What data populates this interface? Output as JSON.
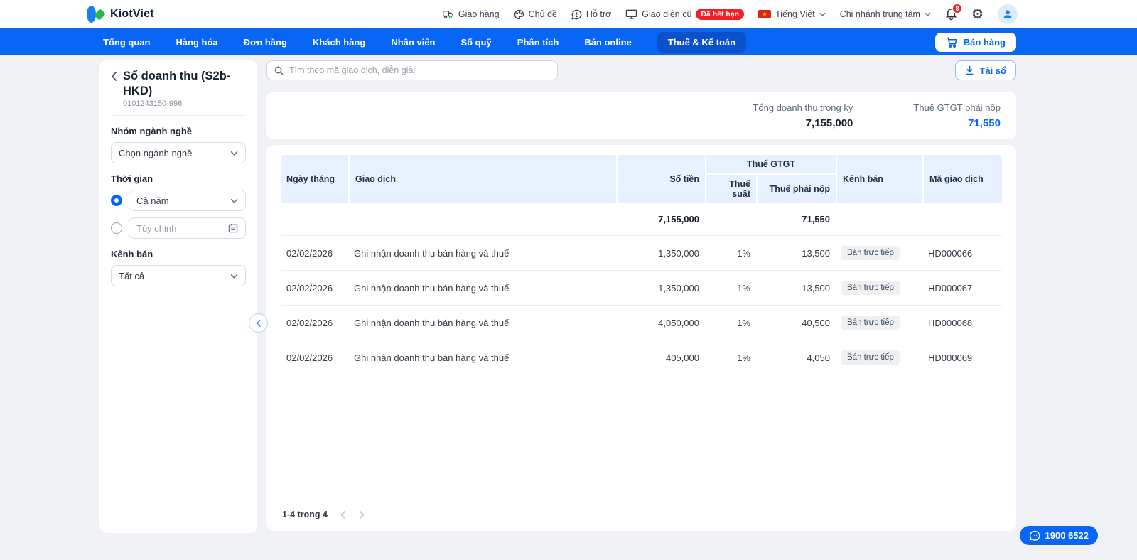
{
  "header": {
    "logo_text": "KiotViet",
    "delivery_label": "Giao hàng",
    "theme_label": "Chủ đề",
    "support_label": "Hỗ trợ",
    "old_ui_label": "Giao diện cũ",
    "expired_badge": "Đã hết hạn",
    "language_label": "Tiếng Việt",
    "branch_label": "Chi nhánh trung tâm",
    "notification_count": "8"
  },
  "nav": {
    "tabs": [
      "Tổng quan",
      "Hàng hóa",
      "Đơn hàng",
      "Khách hàng",
      "Nhân viên",
      "Sổ quỹ",
      "Phân tích",
      "Bán online",
      "Thuế & Kế toán"
    ],
    "active_tab": "Thuế & Kế toán",
    "sell_button": "Bán hàng"
  },
  "page": {
    "title": "Sổ doanh thu (S2b-HKD)",
    "subtitle": "0101243150-996",
    "search_placeholder": "Tìm theo mã giao dịch, diễn giải",
    "download_button": "Tải sổ"
  },
  "filters": {
    "industry_label": "Nhóm ngành nghề",
    "industry_value": "Chọn ngành nghề",
    "time_label": "Thời gian",
    "time_value": "Cả năm",
    "custom_placeholder": "Tùy chỉnh",
    "channel_label": "Kênh bán",
    "channel_value": "Tất cả"
  },
  "summary": {
    "revenue_label": "Tổng doanh thu trong kỳ",
    "revenue_value": "7,155,000",
    "tax_label": "Thuế GTGT phải nộp",
    "tax_value": "71,550"
  },
  "table": {
    "headers": {
      "date": "Ngày tháng",
      "transaction": "Giao dịch",
      "amount": "Số tiền",
      "vat_group": "Thuế GTGT",
      "tax_rate": "Thuế suất",
      "tax_due": "Thuế phải nộp",
      "channel": "Kênh bán",
      "code": "Mã giao dịch"
    },
    "total_row": {
      "amount": "7,155,000",
      "tax_due": "71,550"
    },
    "rows": [
      {
        "date": "02/02/2026",
        "transaction": "Ghi nhận doanh thu bán hàng và thuế",
        "amount": "1,350,000",
        "tax_rate": "1%",
        "tax_due": "13,500",
        "channel": "Bán trực tiếp",
        "code": "HD000066"
      },
      {
        "date": "02/02/2026",
        "transaction": "Ghi nhận doanh thu bán hàng và thuế",
        "amount": "1,350,000",
        "tax_rate": "1%",
        "tax_due": "13,500",
        "channel": "Bán trực tiếp",
        "code": "HD000067"
      },
      {
        "date": "02/02/2026",
        "transaction": "Ghi nhận doanh thu bán hàng và thuế",
        "amount": "4,050,000",
        "tax_rate": "1%",
        "tax_due": "40,500",
        "channel": "Bán trực tiếp",
        "code": "HD000068"
      },
      {
        "date": "02/02/2026",
        "transaction": "Ghi nhận doanh thu bán hàng và thuế",
        "amount": "405,000",
        "tax_rate": "1%",
        "tax_due": "4,050",
        "channel": "Bán trực tiếp",
        "code": "HD000069"
      }
    ],
    "pagination": "1-4 trong 4"
  },
  "support": {
    "phone": "1900 6522"
  },
  "colors": {
    "accent": "#0766f5",
    "nav_active": "#0b51cc",
    "danger": "#ee2224",
    "table_header_bg": "#e7f1fd"
  }
}
